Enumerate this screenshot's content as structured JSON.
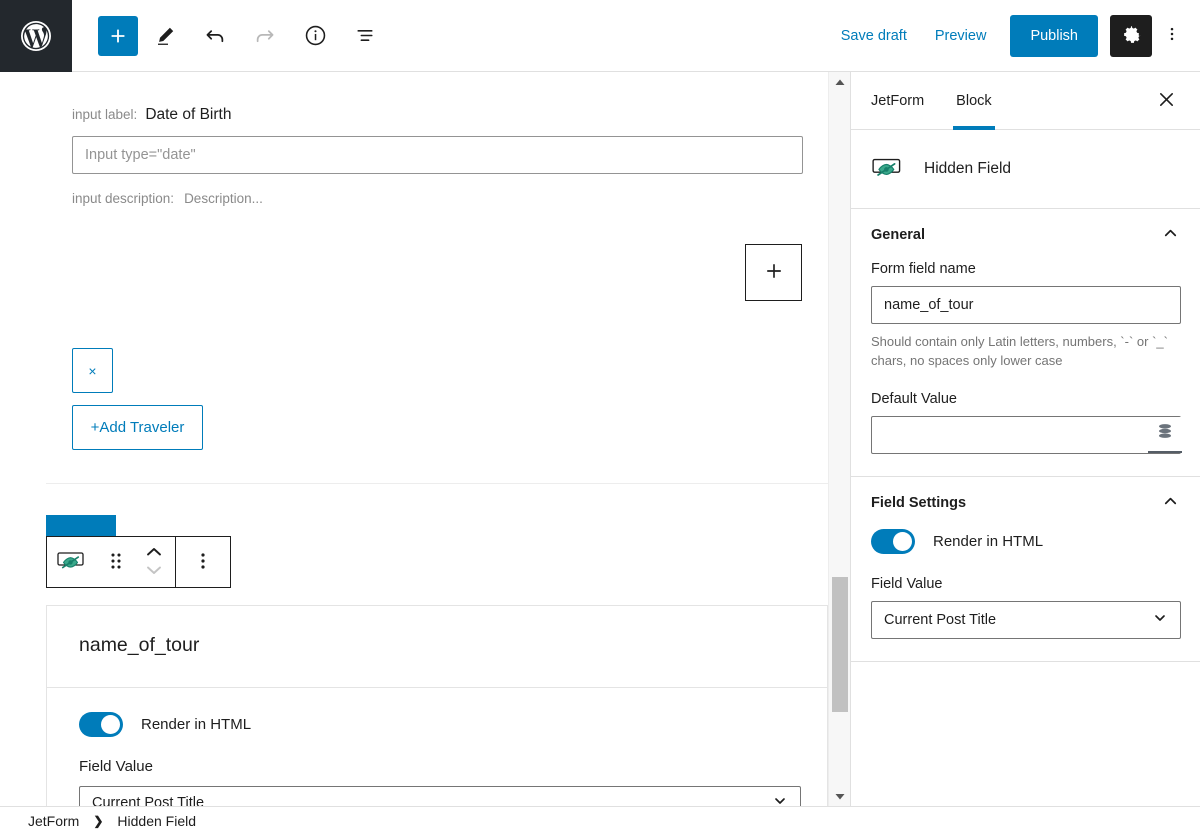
{
  "header": {
    "logo_icon": "wordpress-logo",
    "tools": [
      {
        "name": "add-block-button",
        "icon": "plus-icon",
        "label": "Add block"
      },
      {
        "name": "edit-tool-button",
        "icon": "pencil-icon",
        "label": "Tools"
      },
      {
        "name": "undo-button",
        "icon": "undo-arrow-icon",
        "label": "Undo"
      },
      {
        "name": "redo-button",
        "icon": "redo-arrow-icon",
        "label": "Redo"
      },
      {
        "name": "details-button",
        "icon": "info-circle-icon",
        "label": "Details"
      },
      {
        "name": "list-view-button",
        "icon": "list-view-icon",
        "label": "List view"
      }
    ],
    "save_draft_label": "Save draft",
    "preview_label": "Preview",
    "publish_label": "Publish",
    "settings_icon": "gear-icon",
    "options_icon": "kebab-vertical-icon",
    "accent_color": "#007cba",
    "dark_color": "#1e1e1e"
  },
  "canvas": {
    "form_block": {
      "input_label_prefix": "input label:",
      "input_label_value": "Date of Birth",
      "input_placeholder": "Input type=\"date\"",
      "input_value": "",
      "description_prefix": "input description:",
      "description_value": "Description...",
      "appender_label": "+",
      "remove_label": "×",
      "add_traveler_label": "+Add Traveler"
    },
    "selected_block": {
      "toolbar": {
        "block_icon": "hidden-field-icon",
        "drag_icon": "drag-handle-icon",
        "move_up_icon": "chevron-up-icon",
        "move_down_icon": "chevron-down-icon",
        "more_icon": "kebab-vertical-icon"
      },
      "title": "name_of_tour",
      "render_in_html_label": "Render in HTML",
      "render_in_html_on": true,
      "field_value_label": "Field Value",
      "field_value_selected": "Current Post Title"
    },
    "scrollbar": {
      "up_icon": "scroll-up-arrow-icon",
      "down_icon": "scroll-down-arrow-icon"
    }
  },
  "sidebar": {
    "tabs": [
      {
        "label": "JetForm",
        "active": false
      },
      {
        "label": "Block",
        "active": true
      }
    ],
    "close_icon": "close-x-icon",
    "block_icon": "hidden-field-icon",
    "block_title": "Hidden Field",
    "panels": [
      {
        "title": "General",
        "collapse_icon": "chevron-up-icon",
        "form_field_name_label": "Form field name",
        "form_field_name_value": "name_of_tour",
        "form_field_name_help": "Should contain only Latin letters, numbers, `-` or `_` chars, no spaces only lower case",
        "default_value_label": "Default Value",
        "default_value_value": "",
        "default_value_icon": "database-stack-icon"
      },
      {
        "title": "Field Settings",
        "collapse_icon": "chevron-up-icon",
        "render_in_html_label": "Render in HTML",
        "render_in_html_on": true,
        "field_value_label": "Field Value",
        "field_value_selected": "Current Post Title"
      }
    ]
  },
  "footer": {
    "breadcrumb": [
      "JetForm",
      "Hidden Field"
    ],
    "separator": "❯"
  }
}
